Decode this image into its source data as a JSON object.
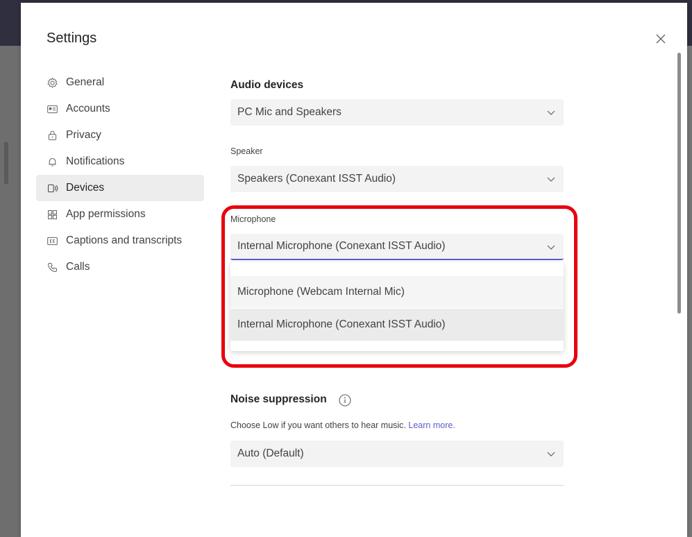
{
  "dialog": {
    "title": "Settings"
  },
  "sidebar": {
    "items": [
      {
        "label": "General",
        "icon": "gear-icon"
      },
      {
        "label": "Accounts",
        "icon": "id-card-icon"
      },
      {
        "label": "Privacy",
        "icon": "lock-icon"
      },
      {
        "label": "Notifications",
        "icon": "bell-icon"
      },
      {
        "label": "Devices",
        "icon": "devices-icon",
        "active": true
      },
      {
        "label": "App permissions",
        "icon": "apps-icon"
      },
      {
        "label": "Captions and transcripts",
        "icon": "cc-icon"
      },
      {
        "label": "Calls",
        "icon": "phone-icon"
      }
    ]
  },
  "audio": {
    "title": "Audio devices",
    "device_value": "PC Mic and Speakers",
    "speaker_label": "Speaker",
    "speaker_value": "Speakers (Conexant ISST Audio)",
    "microphone_label": "Microphone",
    "microphone_value": "Internal Microphone (Conexant ISST Audio)",
    "microphone_options": [
      "Microphone (Webcam Internal Mic)",
      "Internal Microphone (Conexant ISST Audio)"
    ]
  },
  "noise": {
    "title": "Noise suppression",
    "helper": "Choose Low if you want others to hear music.",
    "learn_more": "Learn more.",
    "value": "Auto (Default)"
  },
  "colors": {
    "accent": "#5b5fc7",
    "highlight": "#e8000f",
    "active_nav_bg": "#ededed"
  }
}
